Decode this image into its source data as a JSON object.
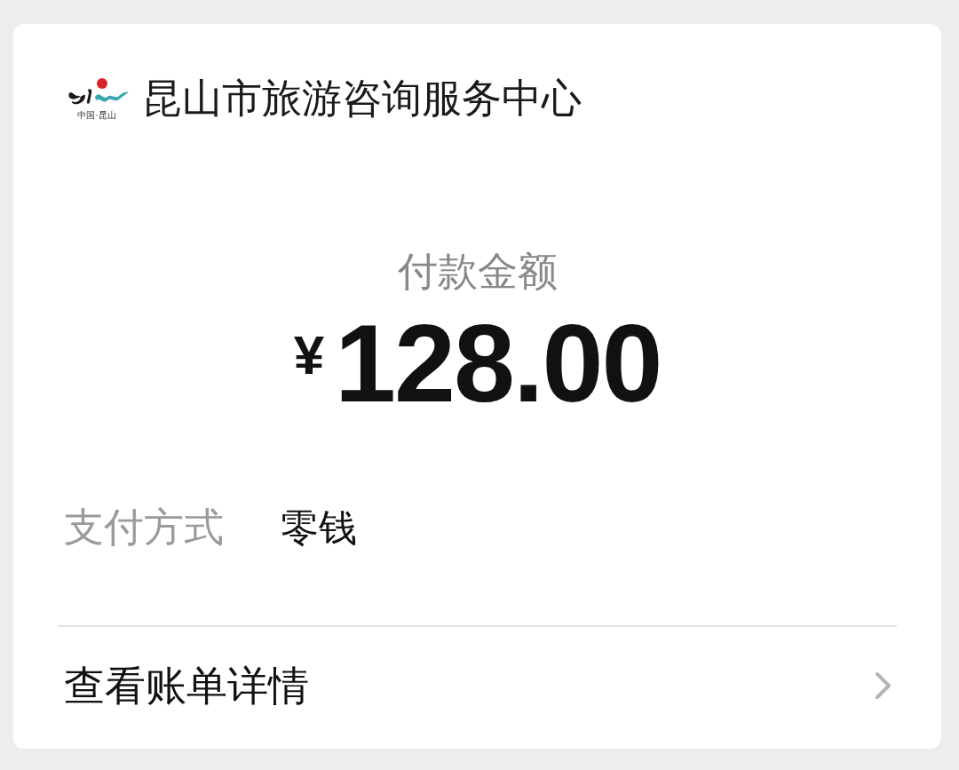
{
  "merchant": {
    "name": "昆山市旅游咨询服务中心",
    "logo_caption": "中国·昆山"
  },
  "payment": {
    "label": "付款金额",
    "currency": "¥",
    "amount": "128.00"
  },
  "details": [
    {
      "label": "支付方式",
      "value": "零钱"
    }
  ],
  "link": {
    "label": "查看账单详情"
  }
}
